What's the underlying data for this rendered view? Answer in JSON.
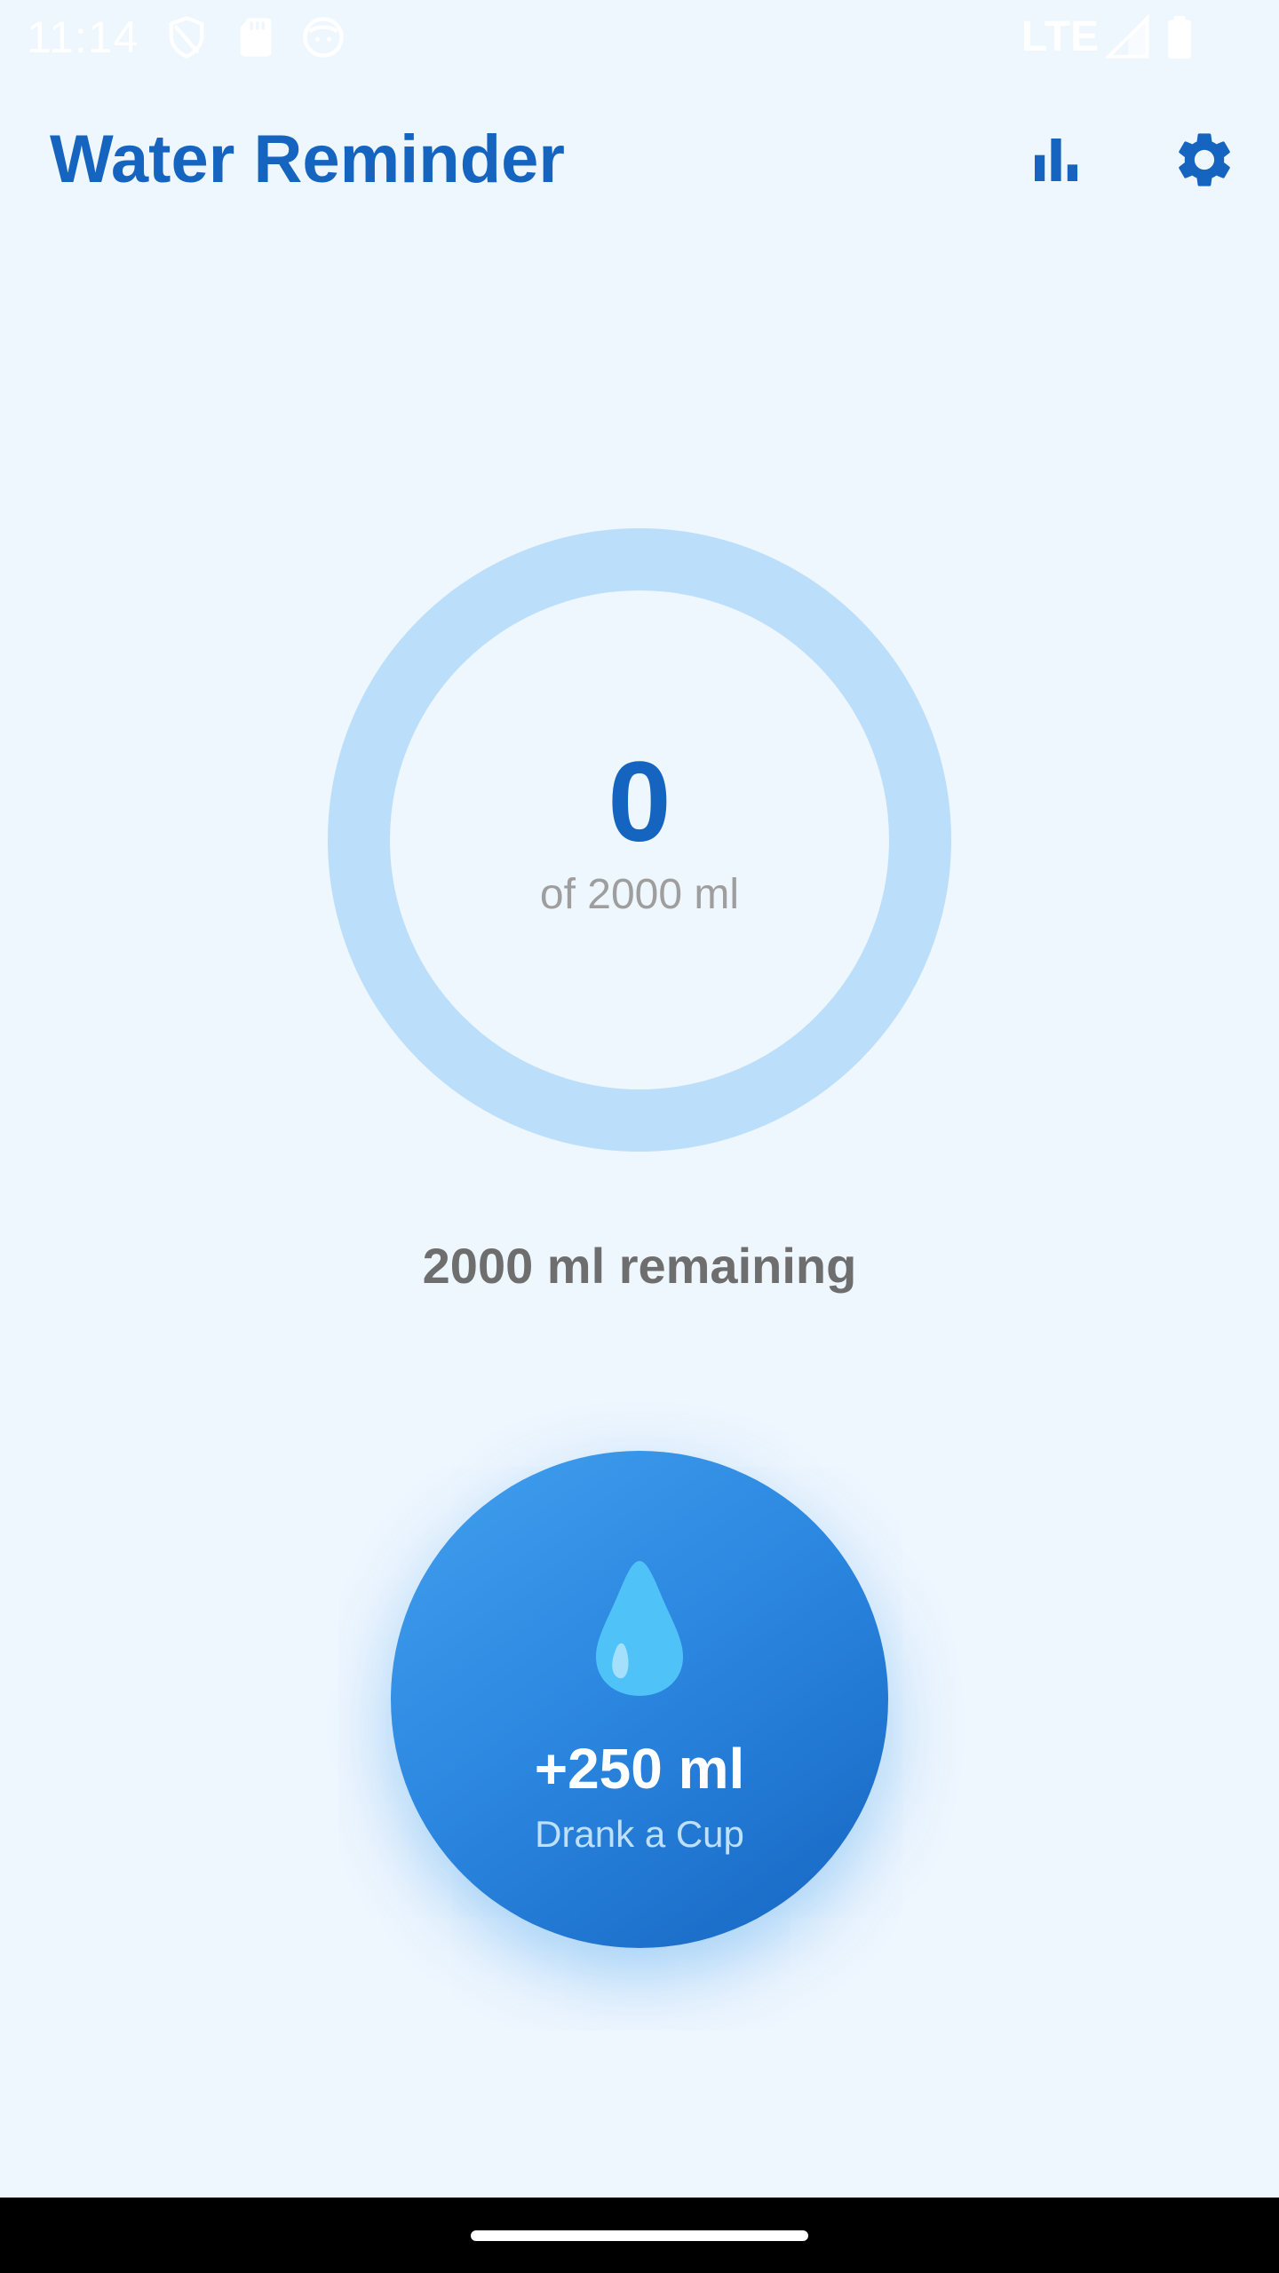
{
  "status_bar": {
    "time": "11:14",
    "network": "LTE",
    "icons": [
      "shield-icon",
      "sd-card-icon",
      "face-icon",
      "signal-icon",
      "battery-icon"
    ]
  },
  "app_bar": {
    "title": "Water Reminder",
    "actions": [
      "stats-icon",
      "settings-icon"
    ]
  },
  "progress": {
    "current": "0",
    "goal_text": "of 2000 ml",
    "fraction": 0.0,
    "remaining_text": "2000 ml remaining"
  },
  "drink_button": {
    "amount": "+250 ml",
    "label": "Drank a Cup",
    "icon": "water-drop-icon"
  },
  "colors": {
    "primary": "#1565C0",
    "background": "#EEF6FE",
    "ring_track": "#BBDEFA",
    "drop": "#4FC3F7"
  }
}
